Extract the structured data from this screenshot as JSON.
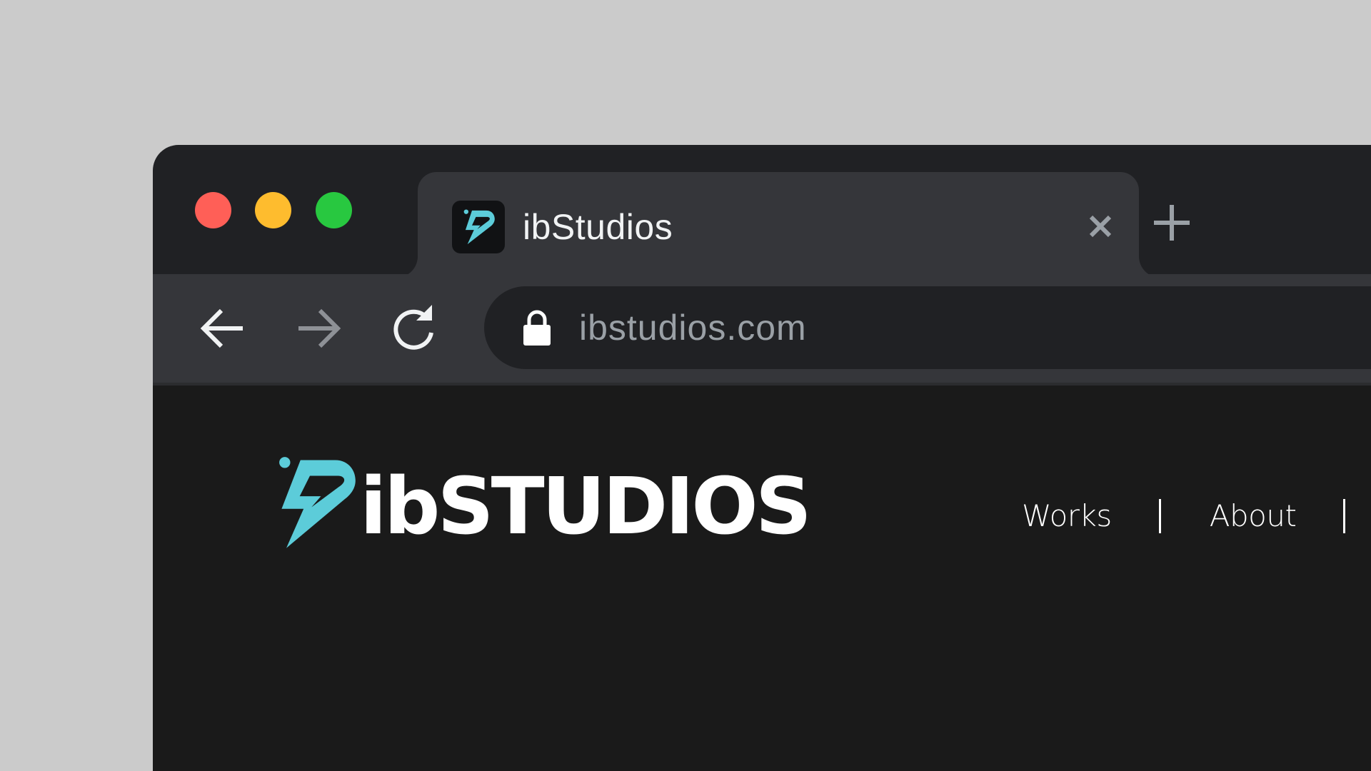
{
  "window": {
    "traffic_lights": [
      {
        "name": "close",
        "color": "#ff5f57"
      },
      {
        "name": "minimize",
        "color": "#febc2e"
      },
      {
        "name": "maximize",
        "color": "#28c840"
      }
    ]
  },
  "tab": {
    "title": "ibStudios",
    "favicon": "ibstudios-logo-icon",
    "close_icon": "close-icon"
  },
  "toolbar": {
    "new_tab_icon": "plus-icon",
    "back_icon": "arrow-left-icon",
    "forward_icon": "arrow-right-icon",
    "reload_icon": "reload-icon",
    "lock_icon": "lock-icon",
    "url": "ibstudios.com"
  },
  "site": {
    "logo_text": "ibSTUDIOS",
    "brand_color": "#5cccd9",
    "background_color": "#1a1a1a",
    "nav": [
      {
        "label": "Works"
      },
      {
        "label": "About"
      }
    ]
  }
}
